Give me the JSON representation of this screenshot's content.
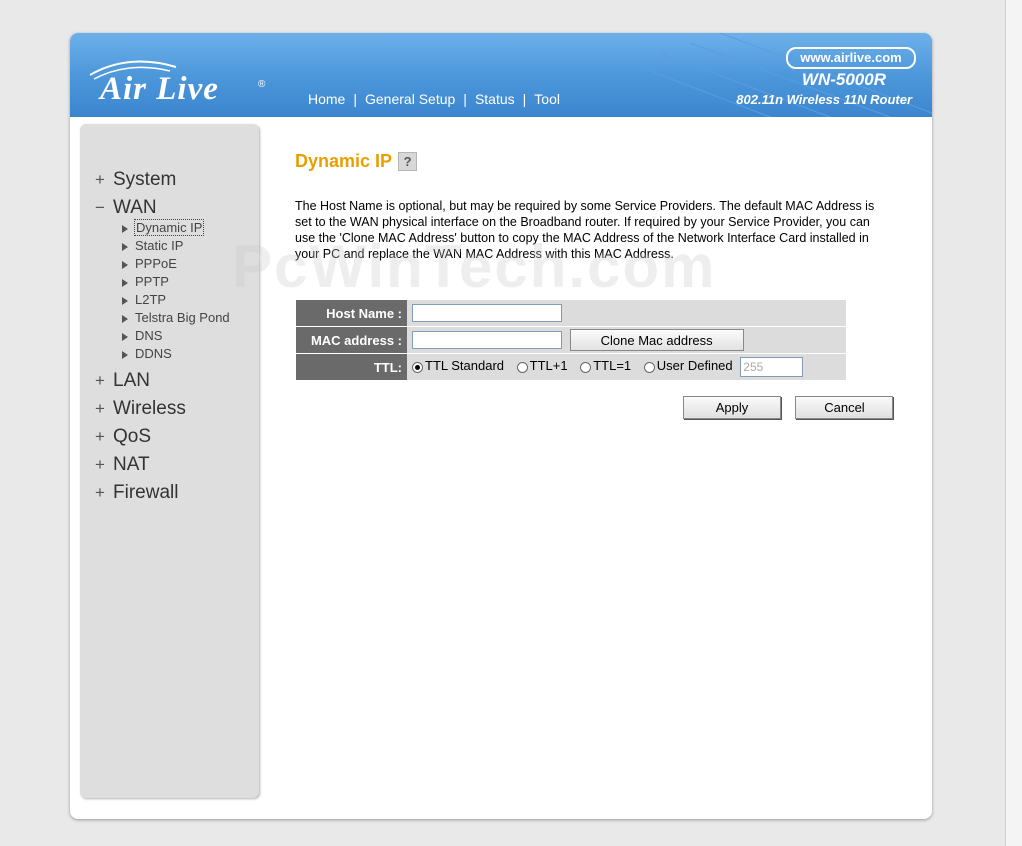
{
  "header": {
    "logo": "Air Live",
    "logo_reg": "®",
    "url": "www.airlive.com",
    "model": "WN-5000R",
    "model_desc": "802.11n Wireless 11N Router",
    "nav": [
      "Home",
      "General Setup",
      "Status",
      "Tool"
    ],
    "nav_sep": "|"
  },
  "sidebar": {
    "top_items": [
      {
        "sym": "+",
        "label": "System"
      },
      {
        "sym": "−",
        "label": "WAN"
      }
    ],
    "wan_subitems": [
      "Dynamic IP",
      "Static IP",
      "PPPoE",
      "PPTP",
      "L2TP",
      "Telstra Big Pond",
      "DNS",
      "DDNS"
    ],
    "bottom_items": [
      {
        "sym": "+",
        "label": "LAN"
      },
      {
        "sym": "+",
        "label": "Wireless"
      },
      {
        "sym": "+",
        "label": "QoS"
      },
      {
        "sym": "+",
        "label": "NAT"
      },
      {
        "sym": "+",
        "label": "Firewall"
      }
    ]
  },
  "main": {
    "title": "Dynamic IP",
    "help_icon": "help-icon",
    "description": "The Host Name is optional, but may be required by some Service Providers. The default MAC Address is set to the WAN physical interface on the Broadband router. If required by your Service Provider, you can use the 'Clone MAC Address' button to copy the MAC Address of the Network Interface Card installed in your PC and replace the WAN MAC Address with this MAC Address.",
    "watermark": "PcWinTech.com",
    "form": {
      "host_label": "Host Name :",
      "host_value": "",
      "mac_label": "MAC address :",
      "mac_value": "",
      "clone_button": "Clone Mac address",
      "ttl_label": "TTL:",
      "ttl_options": [
        "TTL Standard",
        "TTL+1",
        "TTL=1",
        "User Defined"
      ],
      "ttl_selected": "TTL Standard",
      "ttl_value": "255"
    },
    "apply_label": "Apply",
    "cancel_label": "Cancel"
  },
  "colors": {
    "header_blue": "#4d97db",
    "title_orange": "#e8a000",
    "label_gray": "#6a6a6a",
    "sidebar_gray": "#dedede"
  }
}
